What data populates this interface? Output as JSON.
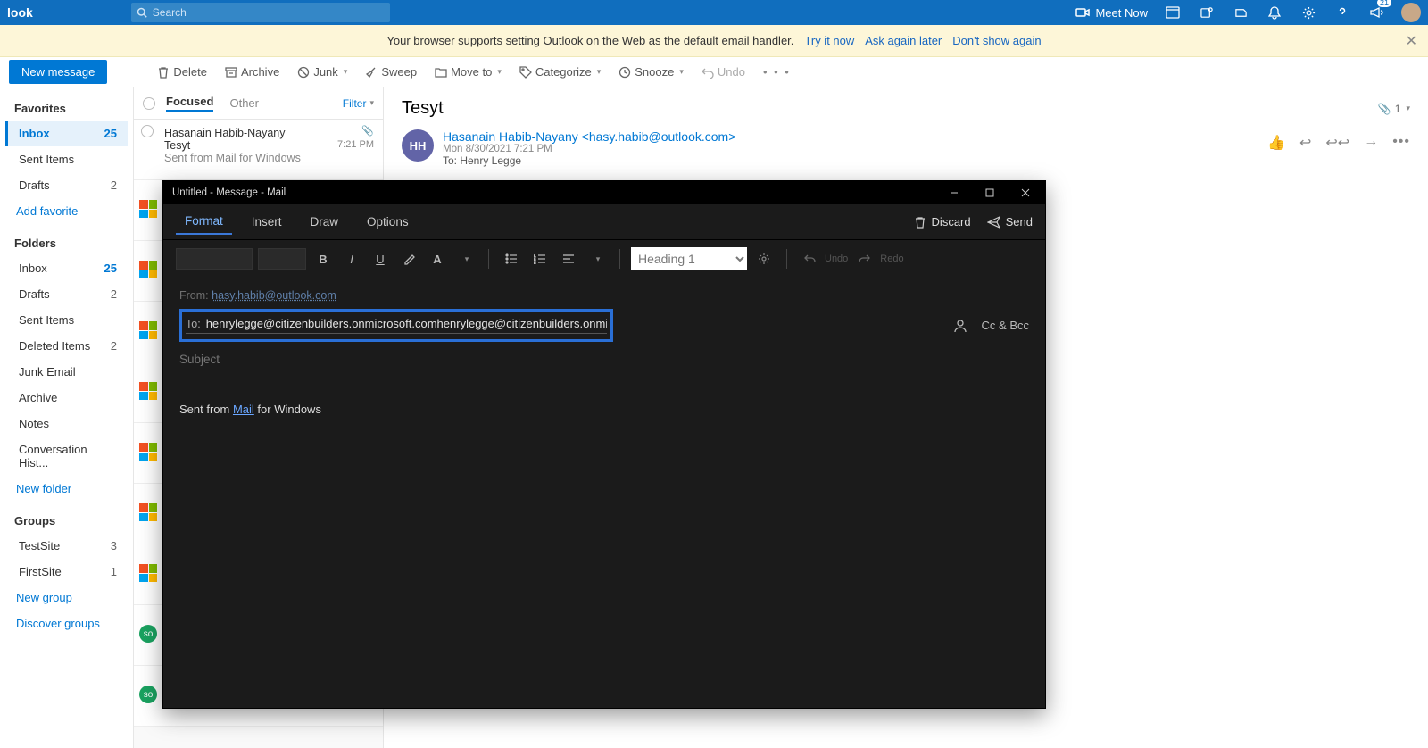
{
  "topbar": {
    "brand": "look",
    "search_placeholder": "Search",
    "meet_now": "Meet Now",
    "badge": "21"
  },
  "banner": {
    "text": "Your browser supports setting Outlook on the Web as the default email handler.",
    "try": "Try it now",
    "ask": "Ask again later",
    "dont": "Don't show again"
  },
  "toolbar": {
    "new_message": "New message",
    "delete": "Delete",
    "archive": "Archive",
    "junk": "Junk",
    "sweep": "Sweep",
    "move": "Move to",
    "categorize": "Categorize",
    "snooze": "Snooze",
    "undo": "Undo"
  },
  "sidebar": {
    "favorites": "Favorites",
    "inbox": "Inbox",
    "inbox_count": "25",
    "sent": "Sent Items",
    "drafts": "Drafts",
    "drafts_count": "2",
    "add_fav": "Add favorite",
    "folders": "Folders",
    "deleted": "Deleted Items",
    "deleted_count": "2",
    "junk": "Junk Email",
    "archive": "Archive",
    "notes": "Notes",
    "conv": "Conversation Hist...",
    "new_folder": "New folder",
    "groups": "Groups",
    "testsite": "TestSite",
    "testsite_count": "3",
    "firstsite": "FirstSite",
    "firstsite_count": "1",
    "new_group": "New group",
    "discover": "Discover groups"
  },
  "msglist": {
    "focused": "Focused",
    "other": "Other",
    "filter": "Filter",
    "sender": "Hasanain Habib-Nayany",
    "subject": "Tesyt",
    "time": "7:21 PM",
    "preview": "Sent from Mail for Windows",
    "avatar_initials": "so"
  },
  "reader": {
    "title": "Tesyt",
    "att_count": "1",
    "initials": "HH",
    "from": "Hasanain Habib-Nayany <hasy.habib@outlook.com>",
    "date": "Mon 8/30/2021 7:21 PM",
    "to": "To:  Henry Legge"
  },
  "compose": {
    "window_title": "Untitled - Message - Mail",
    "tabs": {
      "format": "Format",
      "insert": "Insert",
      "draw": "Draw",
      "options": "Options"
    },
    "discard": "Discard",
    "send": "Send",
    "heading_option": "Heading 1",
    "undo_label": "Undo",
    "redo_label": "Redo",
    "from_label": "From:",
    "from_addr": "hasy.habib@outlook.com",
    "to_label": "To:",
    "to_value": "henrylegge@citizenbuilders.onmicrosoft.comhenrylegge@citizenbuilders.onmic",
    "ccbcc": "Cc & Bcc",
    "subject_placeholder": "Subject",
    "body_prefix": "Sent from ",
    "body_link": "Mail",
    "body_suffix": " for Windows"
  }
}
